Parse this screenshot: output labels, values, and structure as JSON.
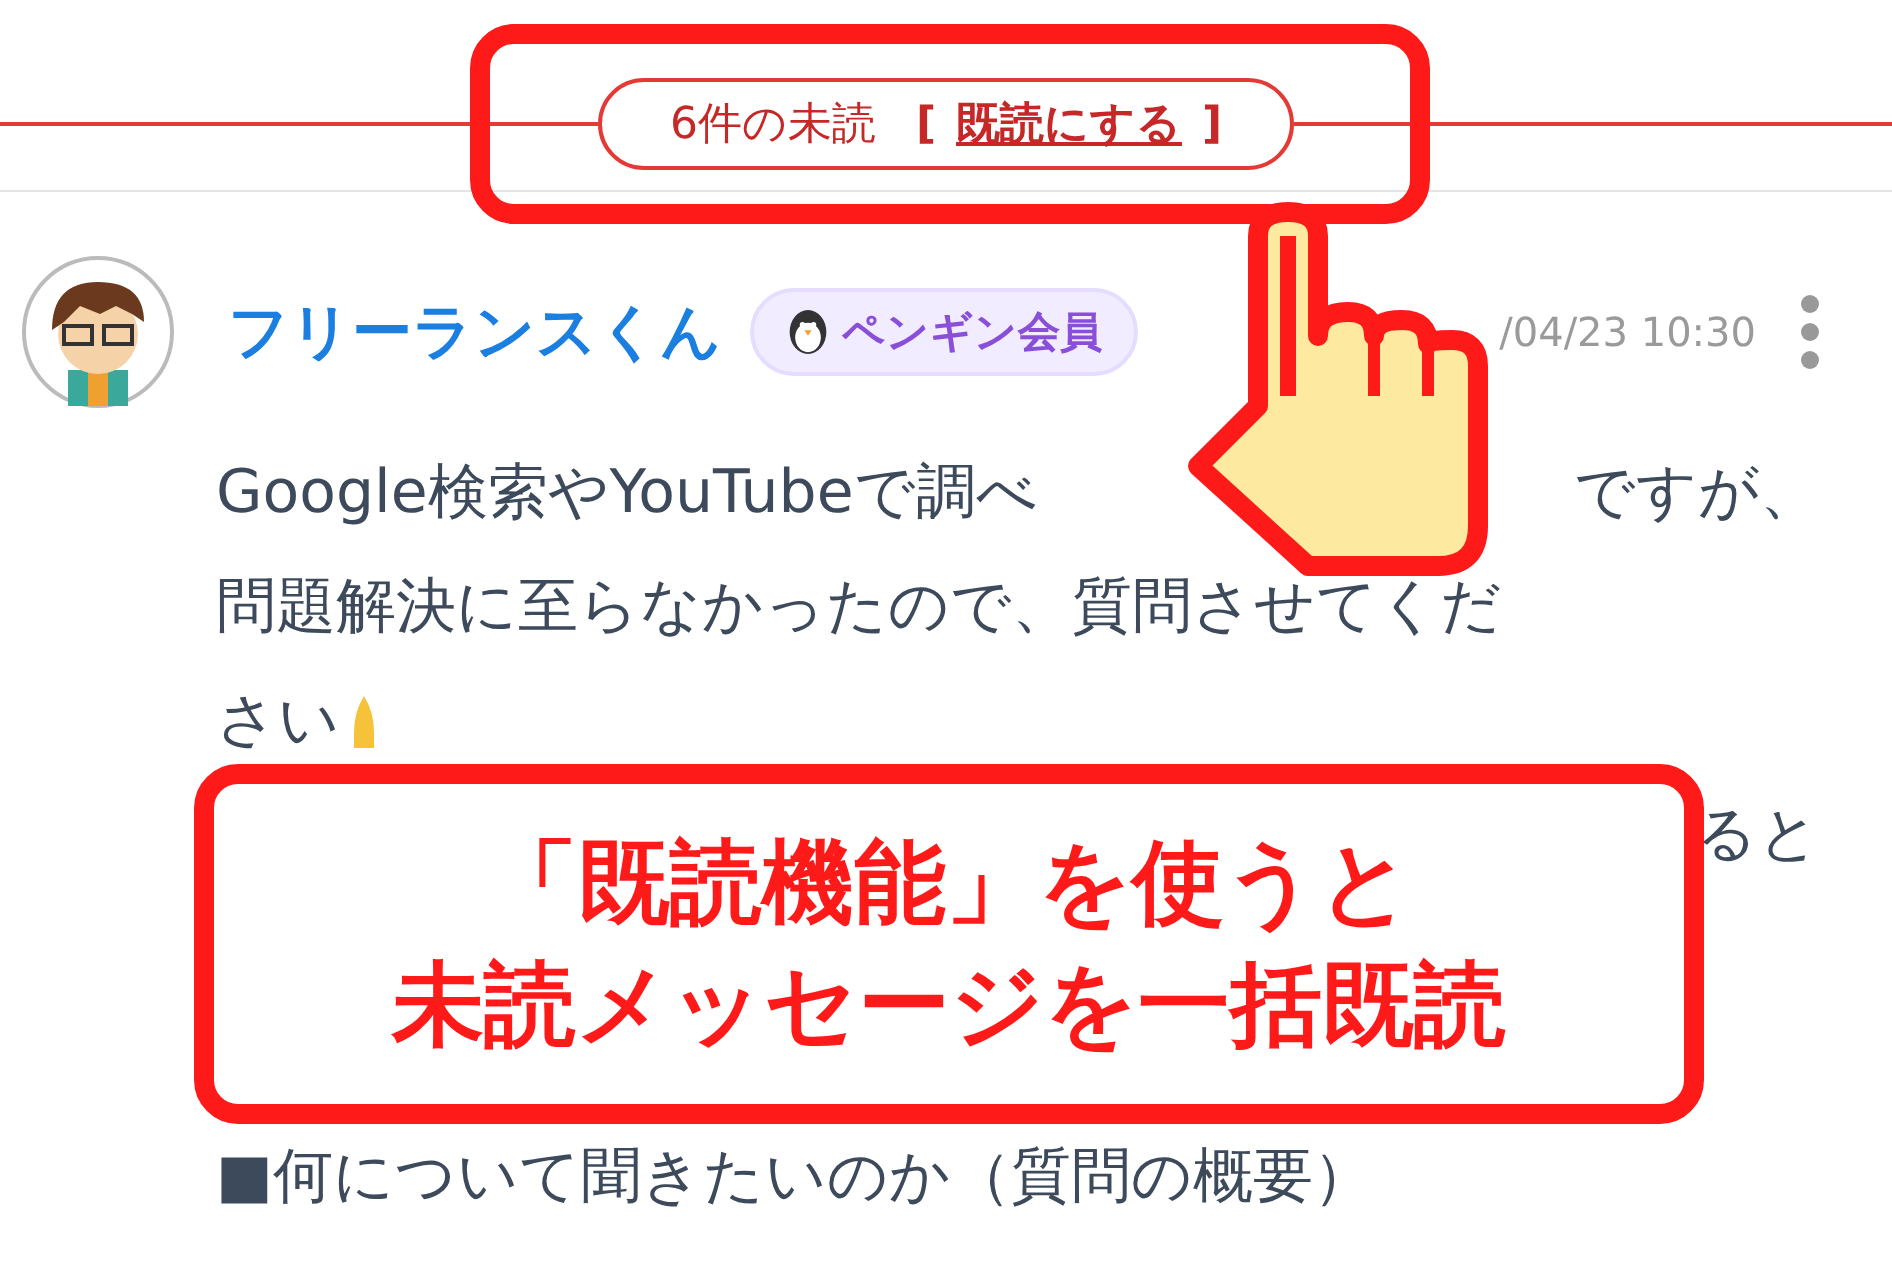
{
  "unread_bar": {
    "count_label": "6件の未読",
    "bracket_open": "[",
    "mark_read_link": "既読にする",
    "bracket_close": "]"
  },
  "message": {
    "author": "フリーランスくん",
    "badge": "ペンギン会員",
    "timestamp": "/04/23 10:30",
    "lines": [
      {
        "kind": "split",
        "left": "Google検索やYouTubeで調べ",
        "right": "ですが、"
      },
      {
        "kind": "plain",
        "left": "問題解決に至らなかったので、質問させてくだ"
      },
      {
        "kind": "icon_end",
        "left": "さい"
      },
      {
        "kind": "split",
        "right": "ると"
      },
      {
        "kind": "plain",
        "left": "■何について聞きたいのか（質問の概要）"
      }
    ]
  },
  "callout": {
    "lines": [
      "「既読機能」を使うと",
      "未読メッセージを一括既読"
    ]
  }
}
